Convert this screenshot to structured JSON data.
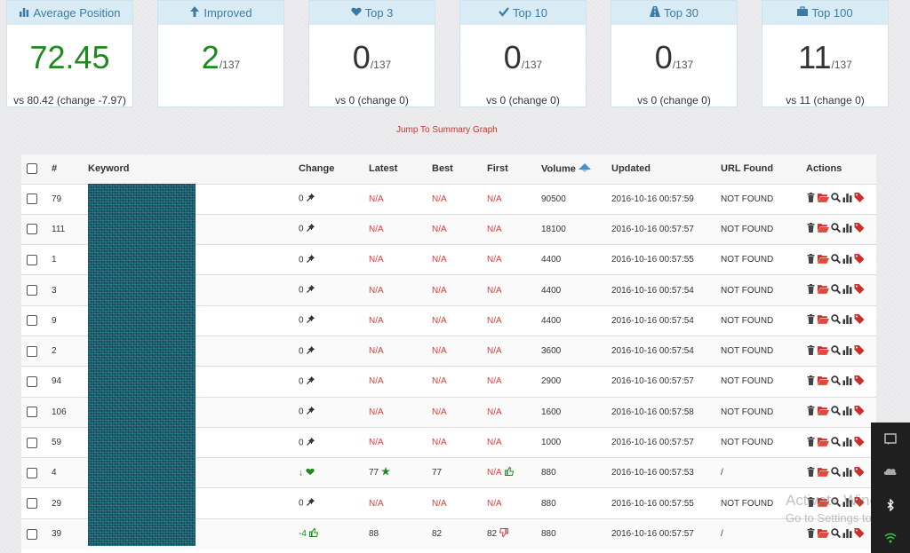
{
  "cards": [
    {
      "title": "Average Position",
      "icon": "bar-chart-icon",
      "big": "72.45",
      "small": "",
      "sub": "vs 80.42 (change -7.97)",
      "color": "#1e8a1e"
    },
    {
      "title": "Improved",
      "icon": "arrow-up-icon",
      "big": "2",
      "small": "/137",
      "sub": "",
      "color": "#1e8a1e"
    },
    {
      "title": "Top 3",
      "icon": "heart-icon",
      "big": "0",
      "small": "/137",
      "sub": "vs 0 (change 0)",
      "color": "#333333"
    },
    {
      "title": "Top 10",
      "icon": "check-icon",
      "big": "0",
      "small": "/137",
      "sub": "vs 0 (change 0)",
      "color": "#333333"
    },
    {
      "title": "Top 30",
      "icon": "road-icon",
      "big": "0",
      "small": "/137",
      "sub": "vs 0 (change 0)",
      "color": "#333333"
    },
    {
      "title": "Top 100",
      "icon": "briefcase-icon",
      "big": "11",
      "small": "/137",
      "sub": "vs 11 (change 0)",
      "color": "#333333"
    }
  ],
  "jump_link": "Jump To Summary Graph",
  "table": {
    "headers": {
      "num": "#",
      "keyword": "Keyword",
      "change": "Change",
      "latest": "Latest",
      "best": "Best",
      "first": "First",
      "volume": "Volume",
      "updated": "Updated",
      "url": "URL Found",
      "actions": "Actions"
    },
    "rows": [
      {
        "num": "79",
        "change": "0",
        "change_icon": "pin-icon",
        "latest": "N/A",
        "latest_icon": "",
        "best": "N/A",
        "first": "N/A",
        "first_icon": "",
        "volume": "90500",
        "updated": "2016-10-16 00:57:59",
        "url": "NOT FOUND"
      },
      {
        "num": "111",
        "change": "0",
        "change_icon": "pin-icon",
        "latest": "N/A",
        "latest_icon": "",
        "best": "N/A",
        "first": "N/A",
        "first_icon": "",
        "volume": "18100",
        "updated": "2016-10-16 00:57:57",
        "url": "NOT FOUND"
      },
      {
        "num": "1",
        "change": "0",
        "change_icon": "pin-icon",
        "latest": "N/A",
        "latest_icon": "",
        "best": "N/A",
        "first": "N/A",
        "first_icon": "",
        "volume": "4400",
        "updated": "2016-10-16 00:57:55",
        "url": "NOT FOUND"
      },
      {
        "num": "3",
        "change": "0",
        "change_icon": "pin-icon",
        "latest": "N/A",
        "latest_icon": "",
        "best": "N/A",
        "first": "N/A",
        "first_icon": "",
        "volume": "4400",
        "updated": "2016-10-16 00:57:54",
        "url": "NOT FOUND"
      },
      {
        "num": "9",
        "change": "0",
        "change_icon": "pin-icon",
        "latest": "N/A",
        "latest_icon": "",
        "best": "N/A",
        "first": "N/A",
        "first_icon": "",
        "volume": "4400",
        "updated": "2016-10-16 00:57:54",
        "url": "NOT FOUND"
      },
      {
        "num": "2",
        "change": "0",
        "change_icon": "pin-icon",
        "latest": "N/A",
        "latest_icon": "",
        "best": "N/A",
        "first": "N/A",
        "first_icon": "",
        "volume": "3600",
        "updated": "2016-10-16 00:57:54",
        "url": "NOT FOUND"
      },
      {
        "num": "94",
        "change": "0",
        "change_icon": "pin-icon",
        "latest": "N/A",
        "latest_icon": "",
        "best": "N/A",
        "first": "N/A",
        "first_icon": "",
        "volume": "2900",
        "updated": "2016-10-16 00:57:57",
        "url": "NOT FOUND"
      },
      {
        "num": "106",
        "change": "0",
        "change_icon": "pin-icon",
        "latest": "N/A",
        "latest_icon": "",
        "best": "N/A",
        "first": "N/A",
        "first_icon": "",
        "volume": "1600",
        "updated": "2016-10-16 00:57:58",
        "url": "NOT FOUND"
      },
      {
        "num": "59",
        "change": "0",
        "change_icon": "pin-icon",
        "latest": "N/A",
        "latest_icon": "",
        "best": "N/A",
        "first": "N/A",
        "first_icon": "",
        "volume": "1000",
        "updated": "2016-10-16 00:57:57",
        "url": "NOT FOUND"
      },
      {
        "num": "4",
        "change": "↓",
        "change_icon": "heart-icon",
        "latest": "77",
        "latest_icon": "star-icon",
        "best": "77",
        "first": "N/A",
        "first_icon": "thumbs-up-icon",
        "volume": "880",
        "updated": "2016-10-16 00:57:53",
        "url": "/"
      },
      {
        "num": "29",
        "change": "0",
        "change_icon": "pin-icon",
        "latest": "N/A",
        "latest_icon": "",
        "best": "N/A",
        "first": "N/A",
        "first_icon": "",
        "volume": "880",
        "updated": "2016-10-16 00:57:55",
        "url": "NOT FOUND"
      },
      {
        "num": "39",
        "change": "-4",
        "change_icon": "thumbs-up-icon",
        "latest": "88",
        "latest_icon": "",
        "best": "82",
        "first": "82",
        "first_icon": "thumbs-down-icon",
        "volume": "880",
        "updated": "2016-10-16 00:57:57",
        "url": "/"
      }
    ]
  },
  "watermark": {
    "line1": "Activate Windows",
    "line2": "Go to Settings to activate Windows."
  },
  "colors": {
    "accent": "#3b7aa6",
    "header_bg": "#d9ecf5",
    "na": "#e03c3c",
    "green": "#1e8a1e"
  }
}
